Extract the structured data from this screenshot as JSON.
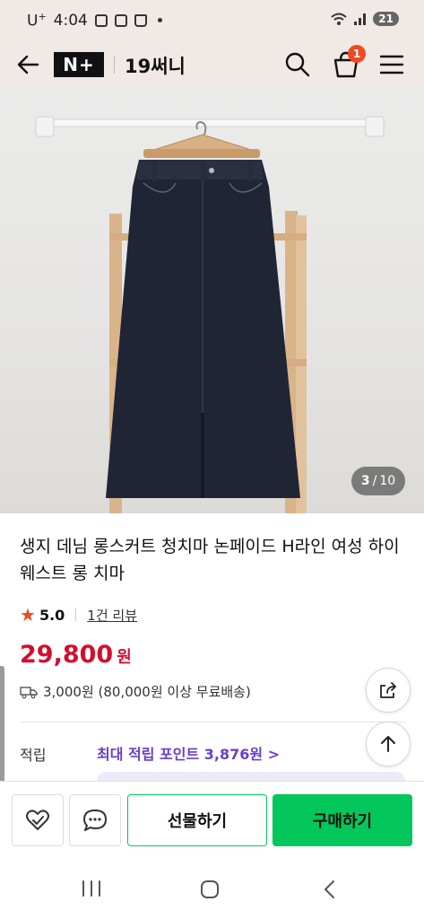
{
  "status_bar": {
    "carrier": "U",
    "carrier_sup": "+",
    "time": "4:04",
    "battery": "21"
  },
  "header": {
    "brand_logo_text": "N+",
    "store_name": "19써니",
    "cart_count": "1",
    "icons": [
      "back-arrow-icon",
      "search-icon",
      "shopping-bag-icon",
      "hamburger-menu-icon"
    ]
  },
  "gallery": {
    "current": "3",
    "separator": "/",
    "total": "10"
  },
  "product": {
    "title": "생지 데님 롱스커트 청치마 논페이드 H라인 여성 하이웨스트 롱 치마",
    "rating": "5.0",
    "review_count": "1건 리뷰",
    "price": "29,800",
    "price_unit": "원",
    "shipping": "3,000원 (80,000원 이상 무료배송)",
    "points_label": "적립",
    "points_link": "최대 적립 포인트 3,876원 >"
  },
  "actions": {
    "gift_label": "선물하기",
    "buy_label": "구매하기"
  },
  "colors": {
    "accent_green": "#03c75a",
    "price_red": "#d40f2e",
    "points_purple": "#6b3fc8",
    "badge_orange": "#f04a23",
    "header_bg": "#f1e9e5"
  }
}
